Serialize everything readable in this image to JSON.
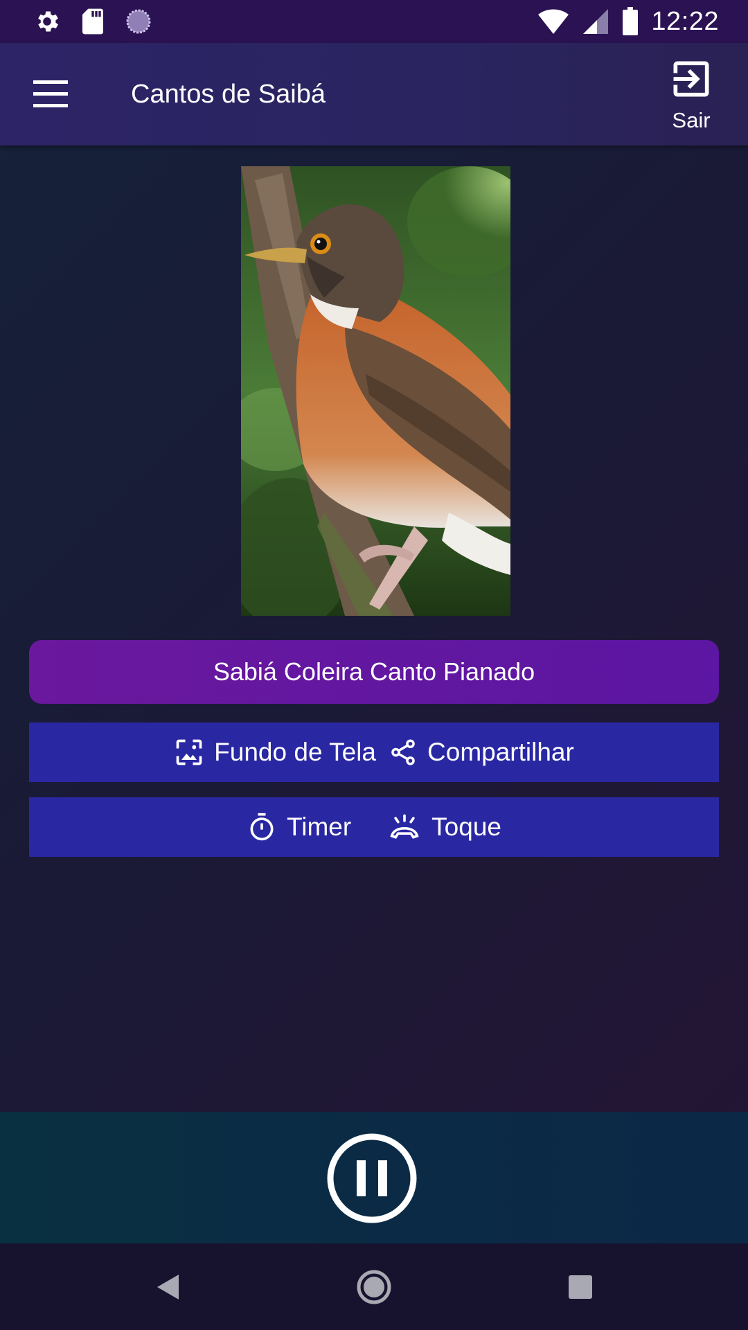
{
  "status_bar": {
    "time": "12:22",
    "left_icons": [
      "gear-icon",
      "sd-card-icon",
      "sync-circle-icon"
    ],
    "right_icons": [
      "wifi-icon",
      "cell-signal-icon",
      "battery-icon"
    ]
  },
  "app_bar": {
    "title": "Cantos de Saibá",
    "exit_label": "Sair",
    "menu_icon": "hamburger-menu-icon",
    "exit_icon": "exit-box-icon"
  },
  "photo": {
    "subject": "bird-photo"
  },
  "song": {
    "title": "Sabiá Coleira Canto Pianado"
  },
  "actions": {
    "wallpaper_label": "Fundo de Tela",
    "share_label": "Compartilhar",
    "timer_label": "Timer",
    "ringtone_label": "Toque"
  },
  "player": {
    "state": "playing",
    "control_icon": "pause-icon"
  },
  "colors": {
    "status_bar": "#2b1252",
    "app_bar": "#2a2560",
    "song_button": "#6a189e",
    "action_button": "#2a27a3",
    "player_bar": "#0b2a46",
    "nav_bar": "#17122e"
  }
}
